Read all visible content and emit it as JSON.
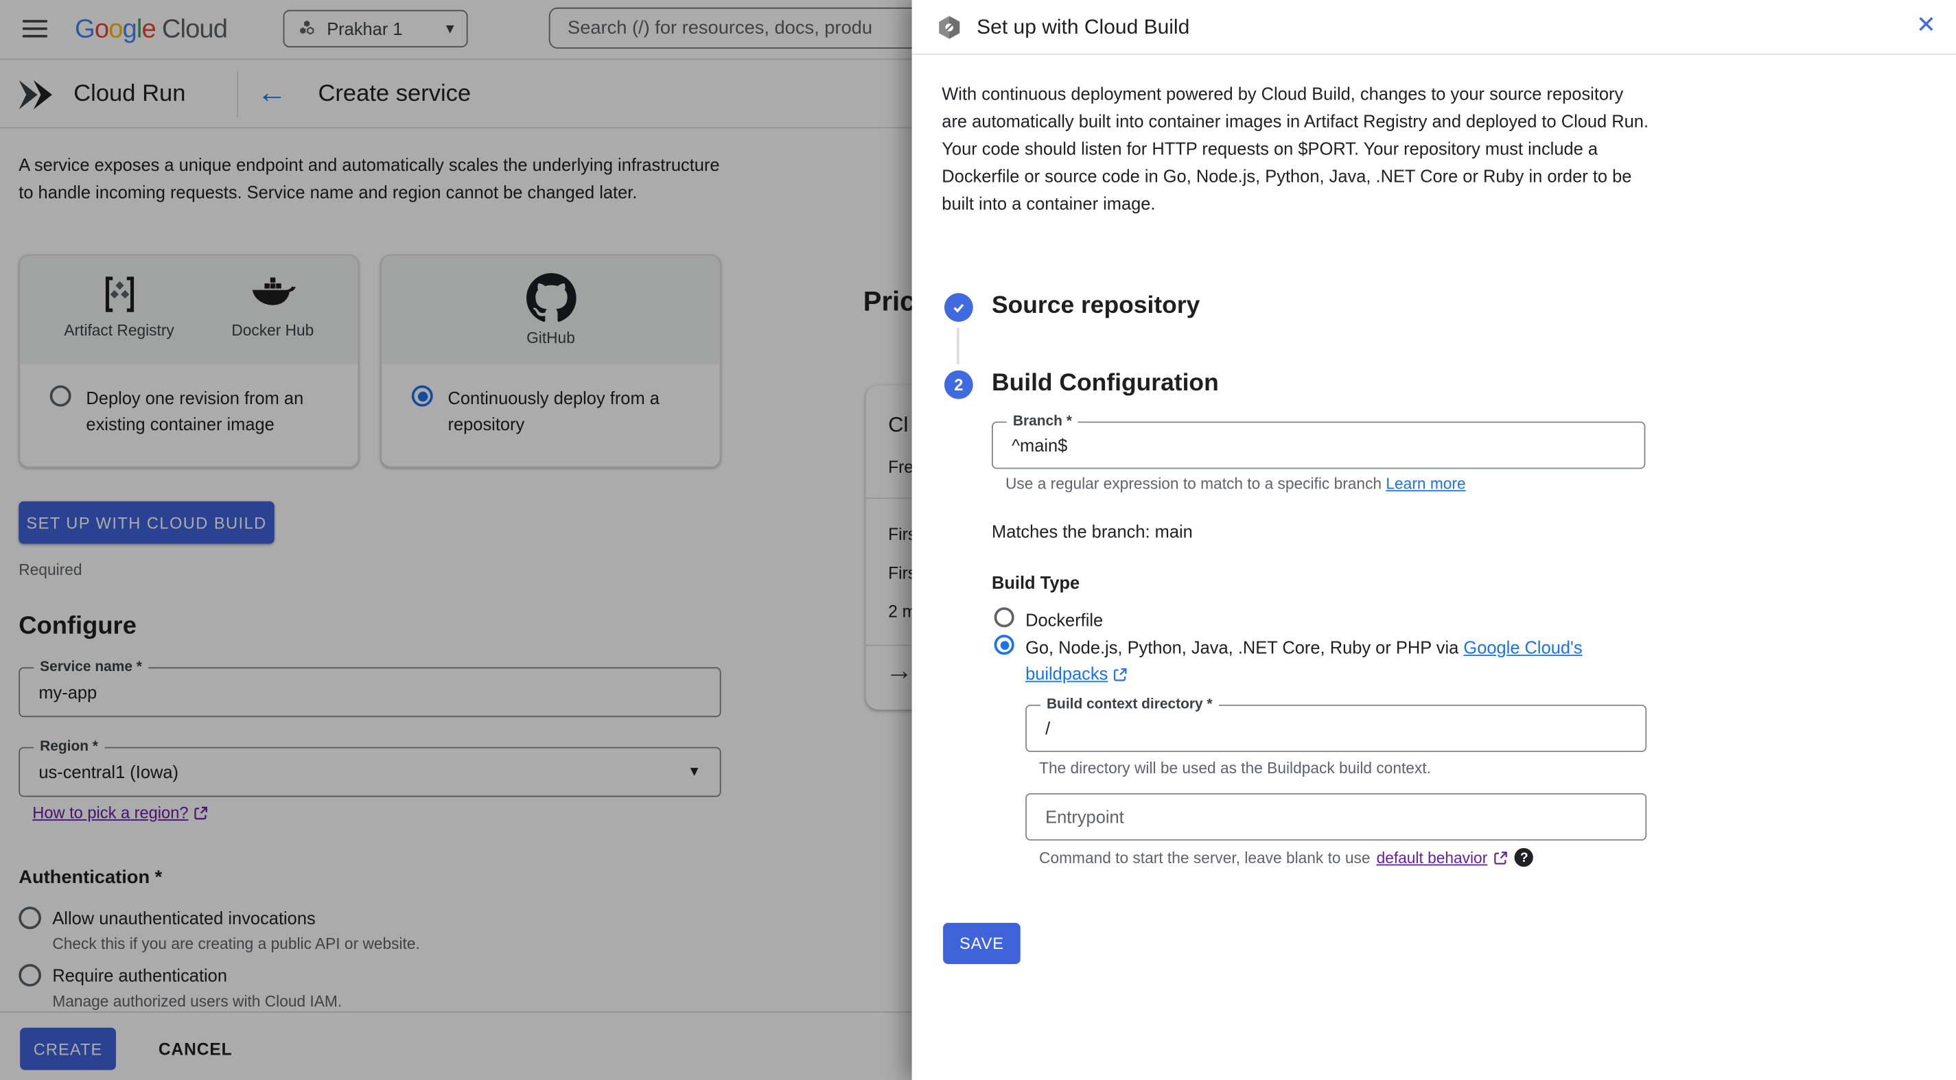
{
  "icons": {
    "caret_down": "▾",
    "dropdown_caret": "▼",
    "back_arrow": "←",
    "forward_arrow": "→",
    "close": "✕",
    "help": "?"
  },
  "colors": {
    "primary_button": "#3f63d9",
    "link_blue": "#1a73e8",
    "visited_link_purple": "#681da8",
    "step_circle_blue": "#3f6ae0",
    "scrim": "rgba(0,0,0,0.33)"
  },
  "topbar": {
    "logo": {
      "letters": [
        "G",
        "o",
        "o",
        "g",
        "l",
        "e"
      ],
      "cloud": "Cloud"
    },
    "project_selector": "Prakhar 1",
    "search_placeholder": "Search (/) for resources, docs, produ"
  },
  "subheader": {
    "product": "Cloud Run",
    "page_title": "Create service"
  },
  "content": {
    "intro": "A service exposes a unique endpoint and automatically scales the underlying infrastructure to handle incoming requests. Service name and region cannot be changed later.",
    "registry_card": {
      "artifact_registry_label": "Artifact Registry",
      "docker_hub_label": "Docker Hub",
      "option_label": "Deploy one revision from an existing container image"
    },
    "github_card": {
      "github_label": "GitHub",
      "option_label": "Continuously deploy from a repository"
    },
    "setup_button_label": "SET UP WITH CLOUD BUILD",
    "required_note": "Required",
    "configure": {
      "heading": "Configure",
      "service_name": {
        "label": "Service name *",
        "value": "my-app"
      },
      "region": {
        "label": "Region *",
        "value": "us-central1 (Iowa)"
      },
      "region_help_link": "How to pick a region?"
    },
    "authentication": {
      "heading": "Authentication *",
      "options": [
        {
          "label": "Allow unauthenticated invocations",
          "description": "Check this if you are creating a public API or website.",
          "selected": false
        },
        {
          "label": "Require authentication",
          "description": "Manage authorized users with Cloud IAM.",
          "selected": false
        }
      ]
    },
    "footer": {
      "create_label": "CREATE",
      "cancel_label": "CANCEL"
    }
  },
  "pricing": {
    "heading_visible": "Pric",
    "card": {
      "title_visible": "Cl",
      "free_visible": "Fre",
      "row1_visible": "Firs",
      "row2_visible": "Firs",
      "row3_visible": "2 m"
    }
  },
  "panel": {
    "title": "Set up with Cloud Build",
    "intro_p1": "With continuous deployment powered by Cloud Build, changes to your source repository are automatically built into container images in Artifact Registry and deployed to Cloud Run.",
    "intro_p2": "Your code should listen for HTTP requests on $PORT. Your repository must include a Dockerfile or source code in Go, Node.js, Python, Java, .NET Core or Ruby in order to be built into a container image.",
    "step1_title": "Source repository",
    "step2_number": "2",
    "step2_title": "Build Configuration",
    "branch": {
      "label": "Branch *",
      "value": "^main$",
      "helper": "Use a regular expression to match to a specific branch",
      "helper_link": "Learn more",
      "match_note": "Matches the branch: main"
    },
    "build_type": {
      "heading": "Build Type",
      "dockerfile_label": "Dockerfile",
      "buildpacks_prefix": "Go, Node.js, Python, Java, .NET Core, Ruby or PHP via",
      "buildpacks_link_line1": "Google Cloud's",
      "buildpacks_link_line2": "buildpacks"
    },
    "context_dir": {
      "label": "Build context directory *",
      "value": "/",
      "helper": "The directory will be used as the Buildpack build context."
    },
    "entrypoint": {
      "placeholder": "Entrypoint",
      "helper": "Command to start the server, leave blank to use",
      "helper_link": "default behavior"
    },
    "save_button_label": "SAVE"
  }
}
